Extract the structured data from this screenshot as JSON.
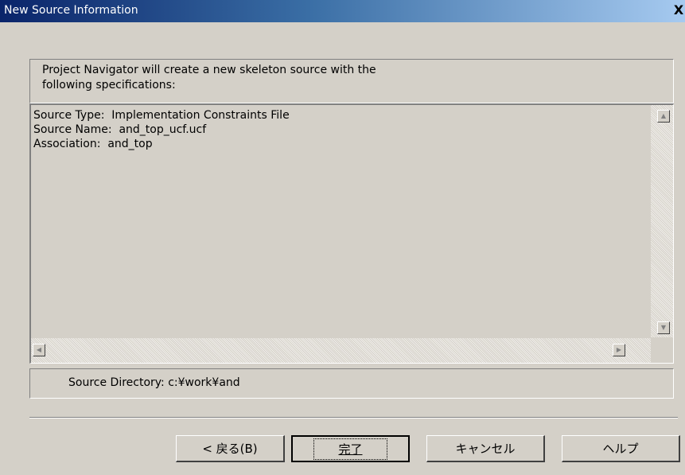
{
  "window": {
    "title": "New Source Information",
    "close_glyph": "X"
  },
  "description": {
    "line1": "Project Navigator will create a new skeleton source with the",
    "line2": "following specifications:"
  },
  "info": {
    "source_type": "Source Type:  Implementation Constraints File",
    "source_name": "Source Name:  and_top_ucf.ucf",
    "association": "Association:  and_top"
  },
  "source_directory": "Source Directory:  c:¥work¥and",
  "buttons": {
    "back": "< 戻る(B)",
    "finish": "完了",
    "cancel": "キャンセル",
    "help": "ヘルプ"
  },
  "icons": {
    "scroll_up": "scroll-up-arrow",
    "scroll_down": "scroll-down-arrow",
    "scroll_left": "scroll-left-arrow",
    "scroll_right": "scroll-right-arrow",
    "close": "close-x"
  }
}
